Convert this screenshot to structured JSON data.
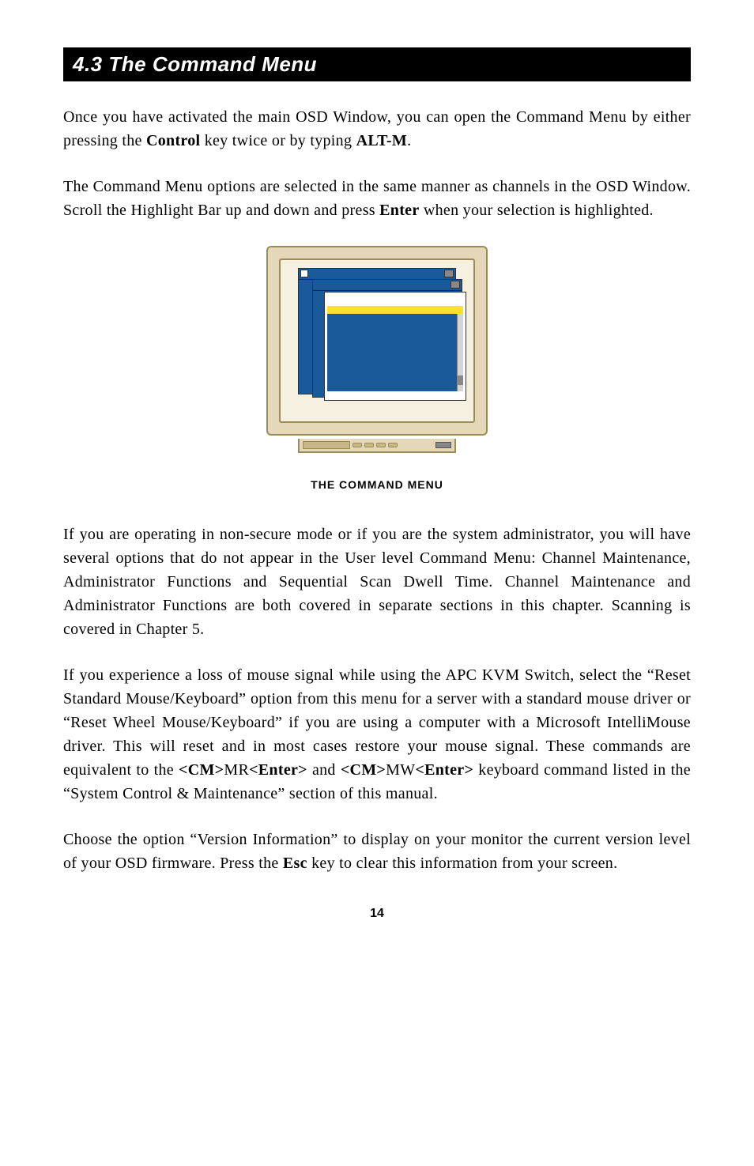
{
  "section": {
    "heading": "4.3 The Command Menu"
  },
  "paragraphs": {
    "p1_a": "Once you have activated the main OSD Window, you can open the Command Menu by either pressing the ",
    "p1_b": "Control",
    "p1_c": " key twice or by typing ",
    "p1_d": "ALT-M",
    "p1_e": ".",
    "p2_a": "The Command Menu options are selected in the same manner as channels in the OSD Window. Scroll the Highlight Bar up and down and press ",
    "p2_b": "Enter",
    "p2_c": " when your selection is highlighted.",
    "p3": "If you are operating in non-secure mode or if you are the system administrator, you will have several options that do not appear in the User level Command Menu: Channel Maintenance, Administrator Functions and Sequential Scan Dwell Time. Channel Maintenance and Administrator Functions are both covered in separate sections in this chapter. Scanning is covered in Chapter 5.",
    "p4_a": "If you experience a loss of mouse signal while using the APC KVM Switch, select the “Reset Standard Mouse/Keyboard” option from this menu for a server with a standard mouse driver or “Reset Wheel Mouse/Keyboard” if you are using a computer with a Microsoft IntelliMouse driver. This will reset and in most cases restore your mouse signal. These commands are equivalent to the ",
    "p4_b": "<CM>",
    "p4_c": "MR",
    "p4_d": "<Enter>",
    "p4_e": " and ",
    "p4_f": "<CM>",
    "p4_g": "MW",
    "p4_h": "<Enter>",
    "p4_i": " keyboard command listed in the “System Control & Maintenance” section of this manual.",
    "p5_a": "Choose the option “Version Information” to display on your monitor the current version level of your OSD firmware. Press the ",
    "p5_b": "Esc",
    "p5_c": " key to clear this information from your screen."
  },
  "figure": {
    "caption": "THE COMMAND MENU"
  },
  "page": {
    "number": "14"
  }
}
